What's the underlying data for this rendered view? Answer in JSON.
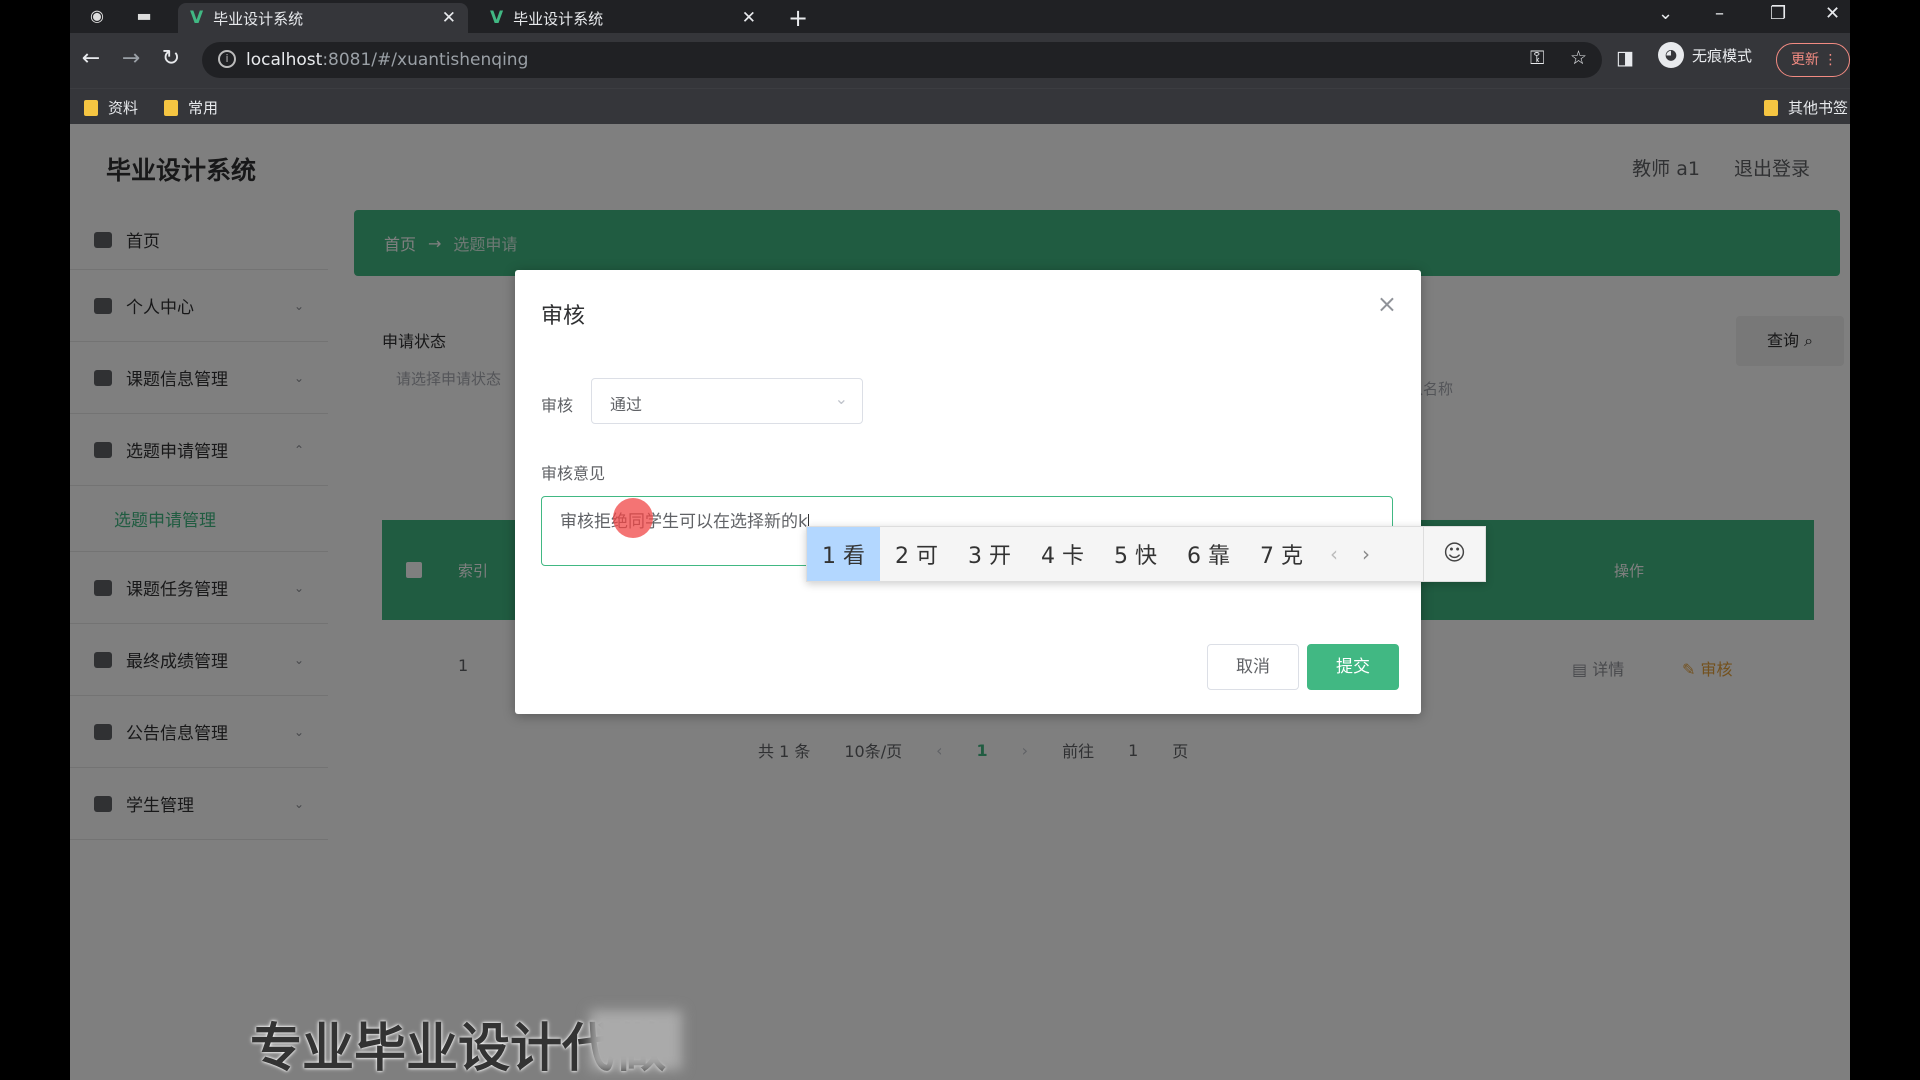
{
  "browser": {
    "tabs": [
      {
        "title": "毕业设计系统",
        "active": true
      },
      {
        "title": "毕业设计系统",
        "active": false
      }
    ],
    "url_host": "localhost",
    "url_rest": ":8081/#/xuantishenqing",
    "incognito_label": "无痕模式",
    "update_label": "更新",
    "bookmarks": [
      "资料",
      "常用"
    ],
    "other_bookmarks": "其他书签"
  },
  "app": {
    "title": "毕业设计系统",
    "user": "教师 a1",
    "logout": "退出登录"
  },
  "sidebar": {
    "items": [
      {
        "label": "首页"
      },
      {
        "label": "个人中心"
      },
      {
        "label": "课题信息管理"
      },
      {
        "label": "选题申请管理"
      },
      {
        "label": "课题任务管理"
      },
      {
        "label": "最终成绩管理"
      },
      {
        "label": "公告信息管理"
      },
      {
        "label": "学生管理"
      }
    ],
    "sub_item": "选题申请管理"
  },
  "content": {
    "breadcrumb": [
      "首页",
      "选题申请"
    ],
    "filter_label": "申请状态",
    "filter_placeholder": "请选择申请状态",
    "right_label": "名",
    "right_placeholder": "请输入名称",
    "query_button": "查询",
    "table_headers": [
      "索引",
      "操作"
    ],
    "row_index": "1",
    "row_actions": [
      "详情",
      "审核"
    ],
    "pager": {
      "total": "共 1 条",
      "page_size": "10条/页",
      "current": "1",
      "goto_label": "前往",
      "goto_value": "1",
      "page_suffix": "页"
    }
  },
  "dialog": {
    "title": "审核",
    "review_label": "审核",
    "review_value": "通过",
    "opinion_label": "审核意见",
    "opinion_text": "审核拒绝同学生可以在选择新的k",
    "cancel": "取消",
    "submit": "提交"
  },
  "ime": {
    "candidates": [
      "1 看",
      "2 可",
      "3 开",
      "4 卡",
      "5 快",
      "6 靠",
      "7 克"
    ]
  },
  "watermark": "专业毕业设计代做"
}
